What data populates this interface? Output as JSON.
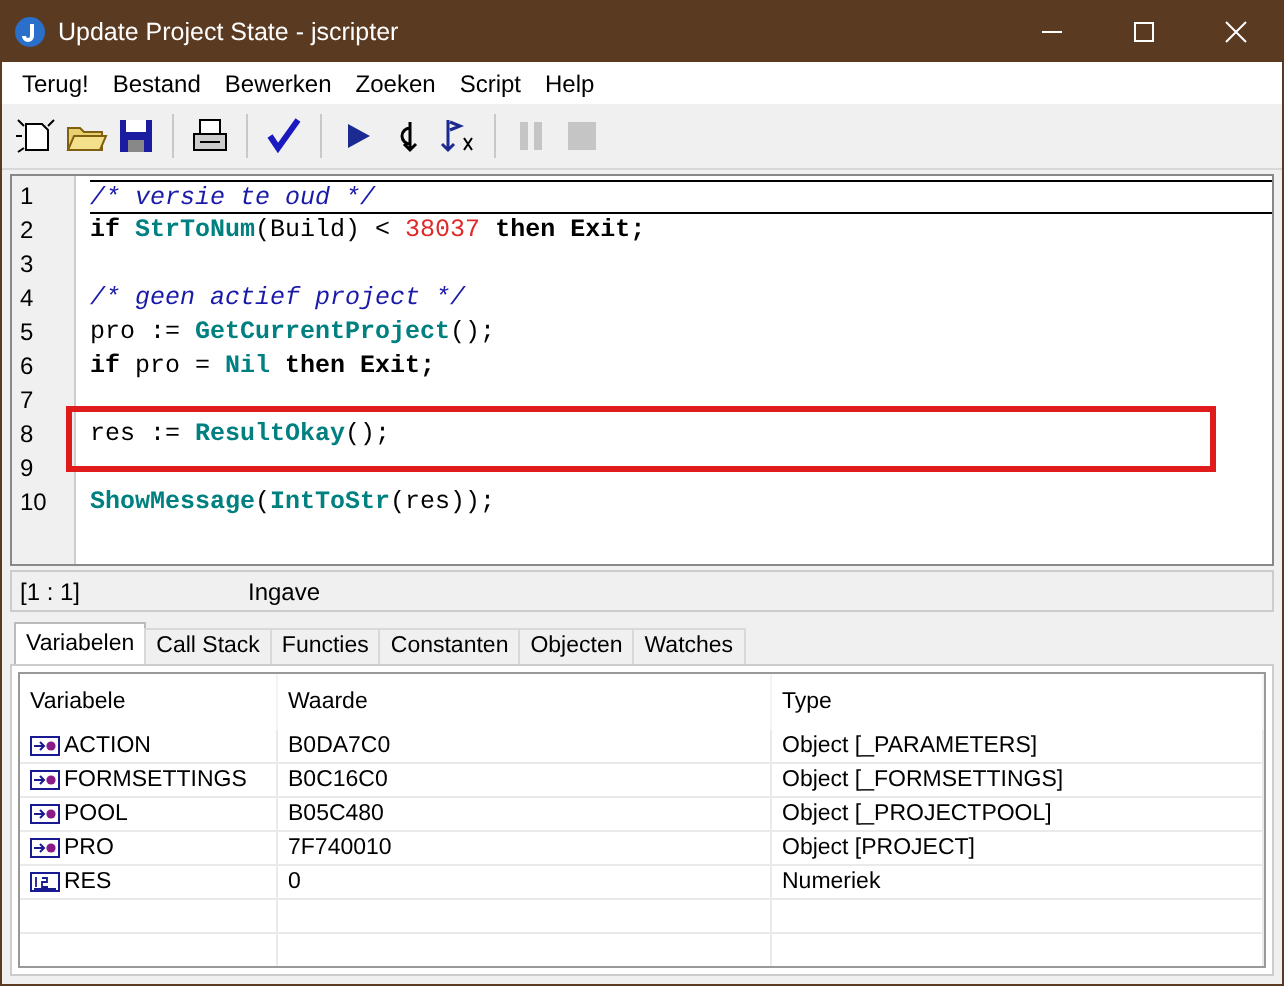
{
  "window": {
    "title": "Update Project State - jscripter"
  },
  "menu": [
    "Terug!",
    "Bestand",
    "Bewerken",
    "Zoeken",
    "Script",
    "Help"
  ],
  "toolbar": [
    {
      "kind": "new"
    },
    {
      "kind": "open"
    },
    {
      "kind": "save"
    },
    {
      "kind": "sep"
    },
    {
      "kind": "print"
    },
    {
      "kind": "sep"
    },
    {
      "kind": "check"
    },
    {
      "kind": "sep"
    },
    {
      "kind": "run"
    },
    {
      "kind": "step"
    },
    {
      "kind": "stepover"
    },
    {
      "kind": "sep"
    },
    {
      "kind": "pause",
      "disabled": true
    },
    {
      "kind": "stop",
      "disabled": true
    }
  ],
  "editor": {
    "lines": [
      {
        "number": "1",
        "highlight": false,
        "tokens": [
          {
            "kind": "comment",
            "text": "/* versie te oud */"
          }
        ]
      },
      {
        "number": "2",
        "highlight": false,
        "tokens": [
          {
            "kind": "keyword",
            "text": "if "
          },
          {
            "kind": "function",
            "text": "StrToNum"
          },
          {
            "kind": "plain",
            "text": "(Build) < "
          },
          {
            "kind": "number",
            "text": "38037"
          },
          {
            "kind": "keyword",
            "text": " then Exit;"
          }
        ]
      },
      {
        "number": "3",
        "highlight": false
      },
      {
        "number": "4",
        "highlight": false,
        "tokens": [
          {
            "kind": "comment",
            "text": "/* geen actief project */"
          }
        ]
      },
      {
        "number": "5",
        "highlight": false,
        "tokens": [
          {
            "kind": "plain",
            "text": "pro := "
          },
          {
            "kind": "function",
            "text": "GetCurrentProject"
          },
          {
            "kind": "plain",
            "text": "();"
          }
        ]
      },
      {
        "number": "6",
        "highlight": false,
        "tokens": [
          {
            "kind": "keyword",
            "text": "if "
          },
          {
            "kind": "plain",
            "text": "pro = "
          },
          {
            "kind": "function",
            "text": "Nil"
          },
          {
            "kind": "keyword",
            "text": " then Exit;"
          }
        ]
      },
      {
        "number": "7",
        "highlight": false
      },
      {
        "number": "8",
        "highlight": true,
        "tokens": [
          {
            "kind": "plain",
            "text": "res := "
          },
          {
            "kind": "function",
            "text": "ResultOkay"
          },
          {
            "kind": "plain",
            "text": "();"
          }
        ]
      },
      {
        "number": "9",
        "highlight": false
      },
      {
        "number": "10",
        "highlight": false,
        "tokens": [
          {
            "kind": "function",
            "text": "ShowMessage"
          },
          {
            "kind": "plain",
            "text": "("
          },
          {
            "kind": "function",
            "text": "IntToStr"
          },
          {
            "kind": "plain",
            "text": "(res));"
          }
        ]
      }
    ]
  },
  "status_bar": {
    "position": "[1 : 1]",
    "mode": "Ingave"
  },
  "tabs": [
    {
      "label": "Variabelen",
      "selected": true
    },
    {
      "label": "Call Stack",
      "selected": false
    },
    {
      "label": "Functies",
      "selected": false
    },
    {
      "label": "Constanten",
      "selected": false
    },
    {
      "label": "Objecten",
      "selected": false
    },
    {
      "label": "Watches",
      "selected": false
    }
  ],
  "table": {
    "columns": [
      "Variabele",
      "Waarde",
      "Type"
    ],
    "rows": [
      {
        "kind": "object",
        "name": "ACTION",
        "value": "B0DA7C0",
        "type": "Object [_PARAMETERS]"
      },
      {
        "kind": "object",
        "name": "FORMSETTINGS",
        "value": "B0C16C0",
        "type": "Object [_FORMSETTINGS]"
      },
      {
        "kind": "object",
        "name": "POOL",
        "value": "B05C480",
        "type": "Object [_PROJECTPOOL]"
      },
      {
        "kind": "object",
        "name": "PRO",
        "value": "7F740010",
        "type": "Object [PROJECT]"
      },
      {
        "kind": "number",
        "name": "RES",
        "value": "0",
        "type": "Numeriek"
      }
    ]
  }
}
